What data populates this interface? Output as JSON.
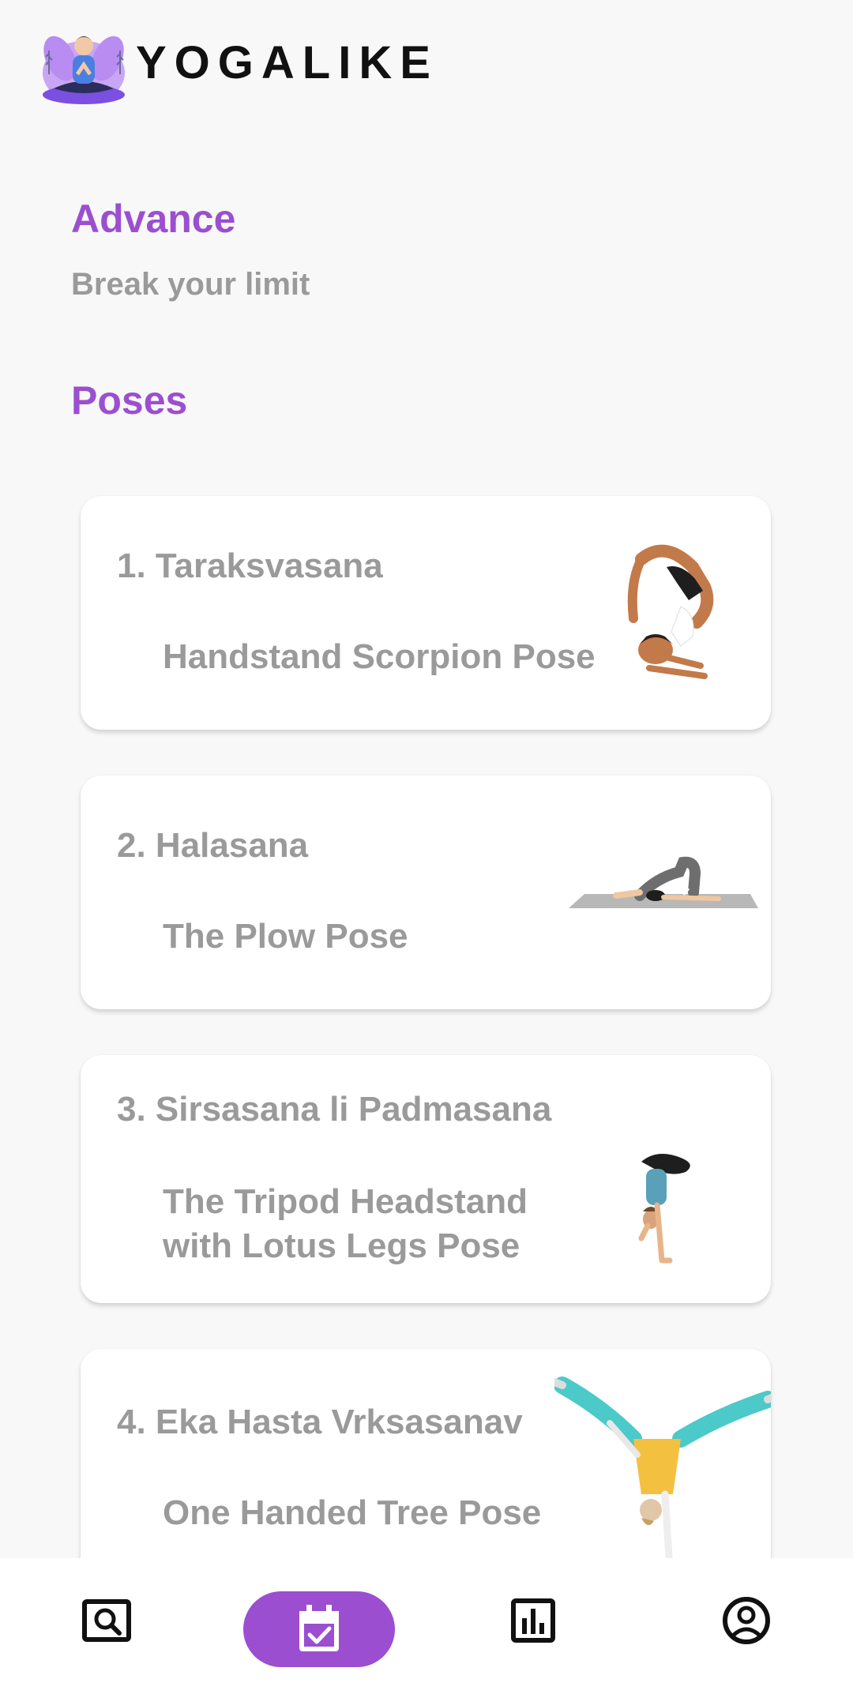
{
  "app": {
    "name": "YOGALIKE"
  },
  "level": {
    "title": "Advance",
    "subtitle": "Break your limit"
  },
  "section": {
    "title": "Poses"
  },
  "poses": [
    {
      "title": "1. Taraksvasana",
      "subtitle": "Handstand Scorpion Pose"
    },
    {
      "title": "2. Halasana",
      "subtitle": "The Plow Pose"
    },
    {
      "title": "3. Sirsasana li Padmasana",
      "subtitle": "The Tripod Headstand with Lotus Legs Pose"
    },
    {
      "title": "4. Eka Hasta Vrksasanav",
      "subtitle": "One Handed Tree Pose"
    }
  ],
  "nav": {
    "items": [
      {
        "icon": "search-image-icon"
      },
      {
        "icon": "calendar-check-icon",
        "active": true
      },
      {
        "icon": "bar-chart-icon"
      },
      {
        "icon": "account-circle-icon"
      }
    ]
  },
  "colors": {
    "accent": "#9b4fd0",
    "muted_text": "#9a9a9a",
    "background": "#f8f8f8"
  }
}
